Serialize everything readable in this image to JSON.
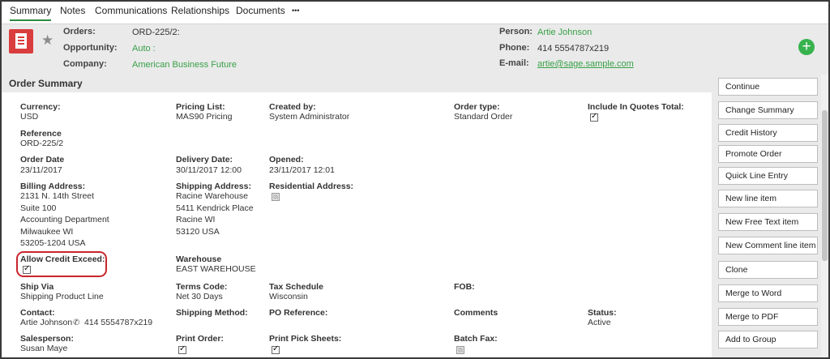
{
  "tabs": [
    {
      "label": "Summary",
      "active": true
    },
    {
      "label": "Notes"
    },
    {
      "label": "Communications"
    },
    {
      "label": "Relationships"
    },
    {
      "label": "Documents"
    },
    {
      "label": "•••"
    }
  ],
  "header": {
    "orders_label": "Orders:",
    "orders_value": "ORD-225/2:",
    "opportunity_label": "Opportunity:",
    "opportunity_value": "Auto :",
    "company_label": "Company:",
    "company_value": "American Business Future",
    "person_label": "Person:",
    "person_value": "Artie Johnson",
    "phone_label": "Phone:",
    "phone_value": "414 5554787x219",
    "email_label": "E-mail:",
    "email_value": "artie@sage.sample.com",
    "add_button": "+"
  },
  "section": {
    "title": "Order Summary"
  },
  "fields": {
    "currency_label": "Currency:",
    "currency_value": "USD",
    "pricing_list_label": "Pricing List:",
    "pricing_list_value": "MAS90 Pricing",
    "created_by_label": "Created by:",
    "created_by_value": "System Administrator",
    "order_type_label": "Order type:",
    "order_type_value": "Standard Order",
    "include_quotes_label": "Include In Quotes Total:",
    "include_quotes_checked": true,
    "reference_label": "Reference",
    "reference_value": "ORD-225/2",
    "order_date_label": "Order Date",
    "order_date_value": "23/11/2017",
    "delivery_date_label": "Delivery Date:",
    "delivery_date_value": "30/11/2017 12:00",
    "opened_label": "Opened:",
    "opened_value": "23/11/2017 12:01",
    "billing_address_label": "Billing Address:",
    "billing_address_lines": [
      "2131 N. 14th Street",
      "Suite 100",
      "Accounting Department",
      "Milwaukee WI",
      "53205-1204 USA"
    ],
    "shipping_address_label": "Shipping Address:",
    "shipping_address_lines": [
      "Racine Warehouse",
      "5411 Kendrick Place",
      "Racine WI",
      "53120 USA"
    ],
    "residential_address_label": "Residential Address:",
    "residential_address_checked": false,
    "allow_credit_label": "Allow Credit Exceed:",
    "allow_credit_checked": true,
    "warehouse_label": "Warehouse",
    "warehouse_value": "EAST WAREHOUSE",
    "ship_via_label": "Ship Via",
    "ship_via_value": "Shipping Product Line",
    "terms_code_label": "Terms Code:",
    "terms_code_value": "Net 30 Days",
    "tax_schedule_label": "Tax Schedule",
    "tax_schedule_value": "Wisconsin",
    "fob_label": "FOB:",
    "contact_label": "Contact:",
    "contact_name": "Artie Johnson",
    "contact_phone": "414 5554787x219",
    "shipping_method_label": "Shipping Method:",
    "po_reference_label": "PO Reference:",
    "comments_label": "Comments",
    "status_label": "Status:",
    "status_value": "Active",
    "salesperson_label": "Salesperson:",
    "salesperson_value": "Susan Maye",
    "print_order_label": "Print Order:",
    "print_order_checked": true,
    "print_pick_sheets_label": "Print Pick Sheets:",
    "print_pick_sheets_checked": true,
    "batch_fax_label": "Batch Fax:",
    "batch_fax_checked": false
  },
  "actions": [
    "Continue",
    "Change Summary",
    "Credit History",
    "Promote Order",
    "Quick Line Entry",
    "New line item",
    "New Free Text item",
    "New Comment line item",
    "Clone",
    "Merge to Word",
    "Merge to PDF",
    "Add to Group"
  ],
  "colors": {
    "accent_green": "#38a047",
    "highlight_red": "#c8262c",
    "icon_red": "#d93d3d"
  }
}
